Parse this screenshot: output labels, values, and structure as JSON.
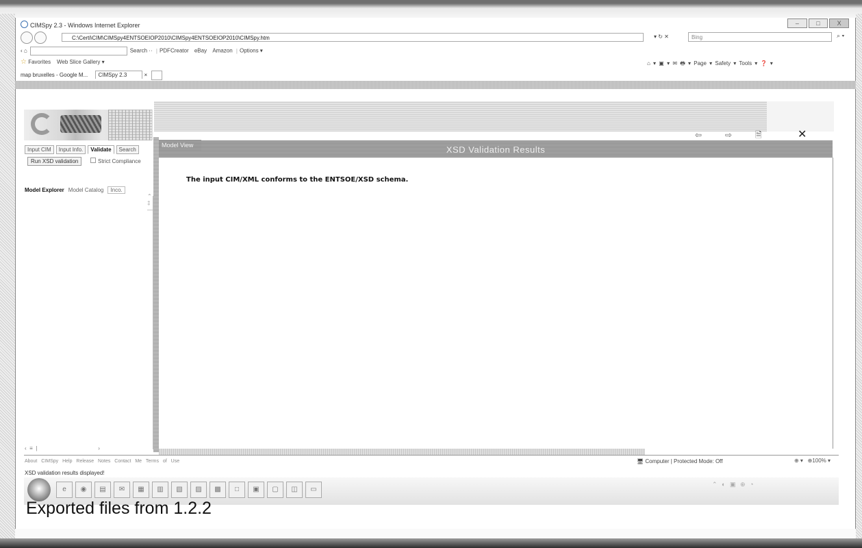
{
  "window": {
    "title": "CIMSpy 2.3 - Windows Internet Explorer",
    "controls": [
      "–",
      "□",
      "X"
    ]
  },
  "address_bar": {
    "url": "C:\\Certi\\CIM\\CIMSpy4ENTSOEIOP2010\\CIMSpy4ENTSOEIOP2010\\CIMSpy.htm",
    "tools": "▾ ↻ ✕",
    "search_placeholder": "Bing",
    "search_go": "⌕ ▾"
  },
  "toolbar": {
    "back_label": "‹ ⌂",
    "search_label": "Search ··",
    "items": [
      "PDFCreator",
      "eBay",
      "Amazon",
      "Options ▾"
    ]
  },
  "favorites_bar": {
    "favorites_label": "Favorites",
    "web_slice": "Web Slice Gallery ▾",
    "commands": "⌂ ▾  ▣ ▾  ✉  🖶 ▾  Page ▾  Safety ▾  Tools ▾  ❓ ▾"
  },
  "tabs": {
    "tab1": "map bruxelles - Google M...",
    "tab2": "CIMSpy 2.3",
    "tab2_close": "×"
  },
  "left_panel": {
    "tabs": [
      "Input CIM",
      "Input Info.",
      "Validate",
      "Search"
    ],
    "active_tab": "Validate",
    "run_button": "Run XSD validation",
    "strict_label": "Strict Compliance",
    "explorer_tabs": [
      "Model Explorer",
      "Model Catalog",
      "Inco."
    ],
    "active_explorer_tab": "Model Explorer",
    "scroll_marks": "⌃\n‡\n—",
    "hscroll": "‹  ≡  |                                        ›"
  },
  "main_view": {
    "tab_label": "Model View",
    "icons": [
      "back-arrow",
      "forward-arrow",
      "document"
    ],
    "icon_glyphs": [
      "⇦",
      "⇨",
      "🗎"
    ],
    "close_glyph": "✕",
    "results_title": "XSD Validation Results",
    "message": "The input CIM/XML conforms to the ENTSOE/XSD schema."
  },
  "footer": {
    "links": "About CIMSpy  Help  Release Notes  Contact Me  Terms of Use",
    "status": "XSD validation results displayed!",
    "zone": "Computer | Protected Mode: Off",
    "zoom": "⊕ ▾   ⊕100% ▾"
  },
  "taskbar": {
    "tray": "⌃ ◐ ▣ ⊕ ◔"
  },
  "caption": "Exported files from 1.2.2"
}
